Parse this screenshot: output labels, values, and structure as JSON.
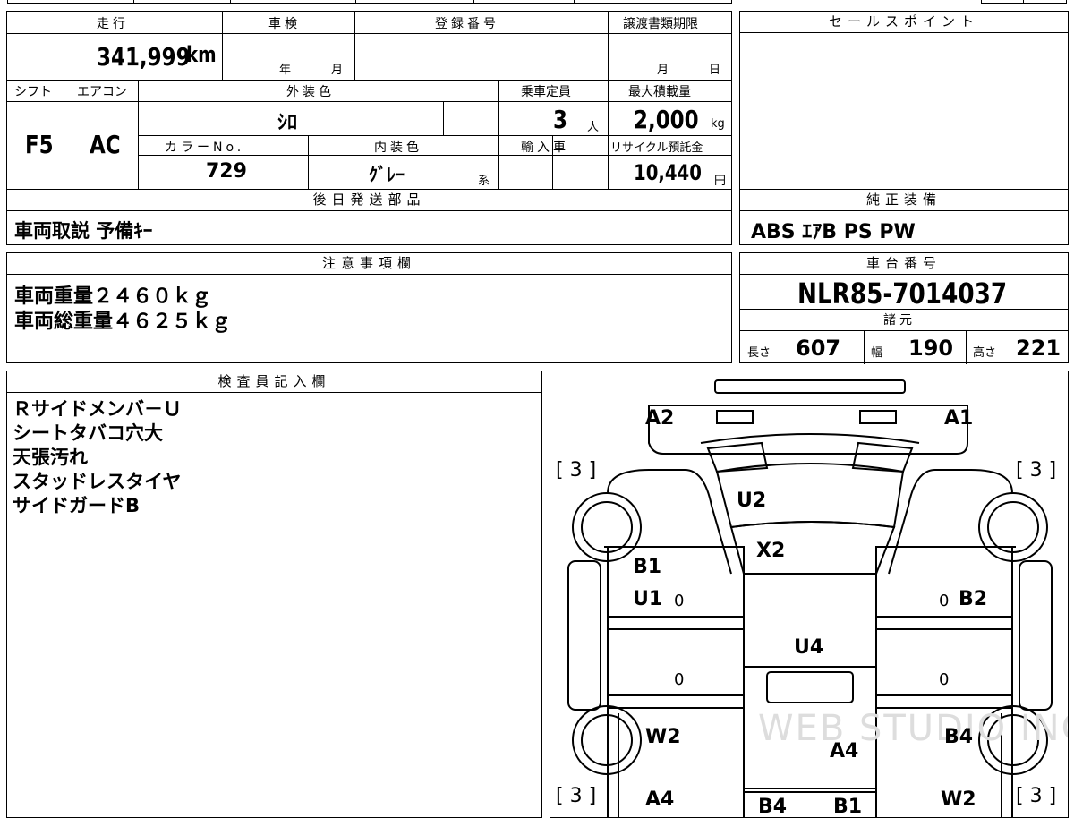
{
  "header": {
    "mileage_label": "走行",
    "inspection_label": "車検",
    "registration_label": "登録番号",
    "transfer_deadline_label": "譲渡書類期限",
    "mileage_value": "341,999",
    "mileage_unit": "km",
    "year_unit": "年",
    "month_unit": "月",
    "deadline_month": "月",
    "deadline_day": "日"
  },
  "specs": {
    "shift_label": "シフト",
    "aircon_label": "エアコン",
    "exterior_color_label": "外装色",
    "capacity_label": "乗車定員",
    "max_load_label": "最大積載量",
    "shift_value": "F5",
    "aircon_value": "AC",
    "exterior_color_value": "ｼﾛ",
    "capacity_value": "3",
    "capacity_unit": "人",
    "max_load_value": "2,000",
    "max_load_unit": "kg",
    "color_no_label": "カラーNo.",
    "interior_color_label": "内装色",
    "import_label": "輸入車",
    "recycle_label": "リサイクル預託金",
    "color_no_value": "729",
    "interior_color_value": "ｸﾞﾚｰ",
    "interior_color_suffix": "系",
    "recycle_value": "10,440",
    "recycle_unit": "円"
  },
  "sales_point": {
    "label": "セールスポイント",
    "text": ""
  },
  "later_parts": {
    "label": "後日発送部品",
    "text": "車両取説 予備ｷｰ"
  },
  "standard_equipment": {
    "label": "純正装備",
    "text": "ABS ｴｱB PS PW"
  },
  "notes": {
    "label": "注意事項欄",
    "lines": [
      "車両重量２４６０ｋｇ",
      "車両総重量４６２５ｋｇ"
    ]
  },
  "chassis": {
    "label": "車台番号",
    "value": "NLR85-7014037"
  },
  "dimensions": {
    "label": "諸元",
    "length_label": "長さ",
    "length_value": "607",
    "width_label": "幅",
    "width_value": "190",
    "height_label": "高さ",
    "height_value": "221"
  },
  "inspector": {
    "label": "検査員記入欄",
    "lines": [
      "Ｒサイドメンバ－Ｕ",
      "シートタバコ穴大",
      "天張汚れ",
      "スタッドレスタイヤ",
      "サイドガードB"
    ]
  },
  "diagram": {
    "marks": {
      "a2": "A2",
      "a1": "A1",
      "u2": "U2",
      "x2": "X2",
      "b1": "B1",
      "u1": "U1",
      "b2": "B2",
      "u4": "U4",
      "w2_left": "W2",
      "a4_center": "A4",
      "b4_right": "B4",
      "a4_left": "A4",
      "b4_bottom": "B4",
      "b1_bottom": "B1",
      "w2_right": "W2"
    },
    "tire_tl": "[ 3 ]",
    "tire_tr": "[ 3 ]",
    "tire_bl": "[ 3 ]",
    "tire_br": "[ 3 ]",
    "zero": "0",
    "watermark": "WEB STUDIO INC"
  }
}
